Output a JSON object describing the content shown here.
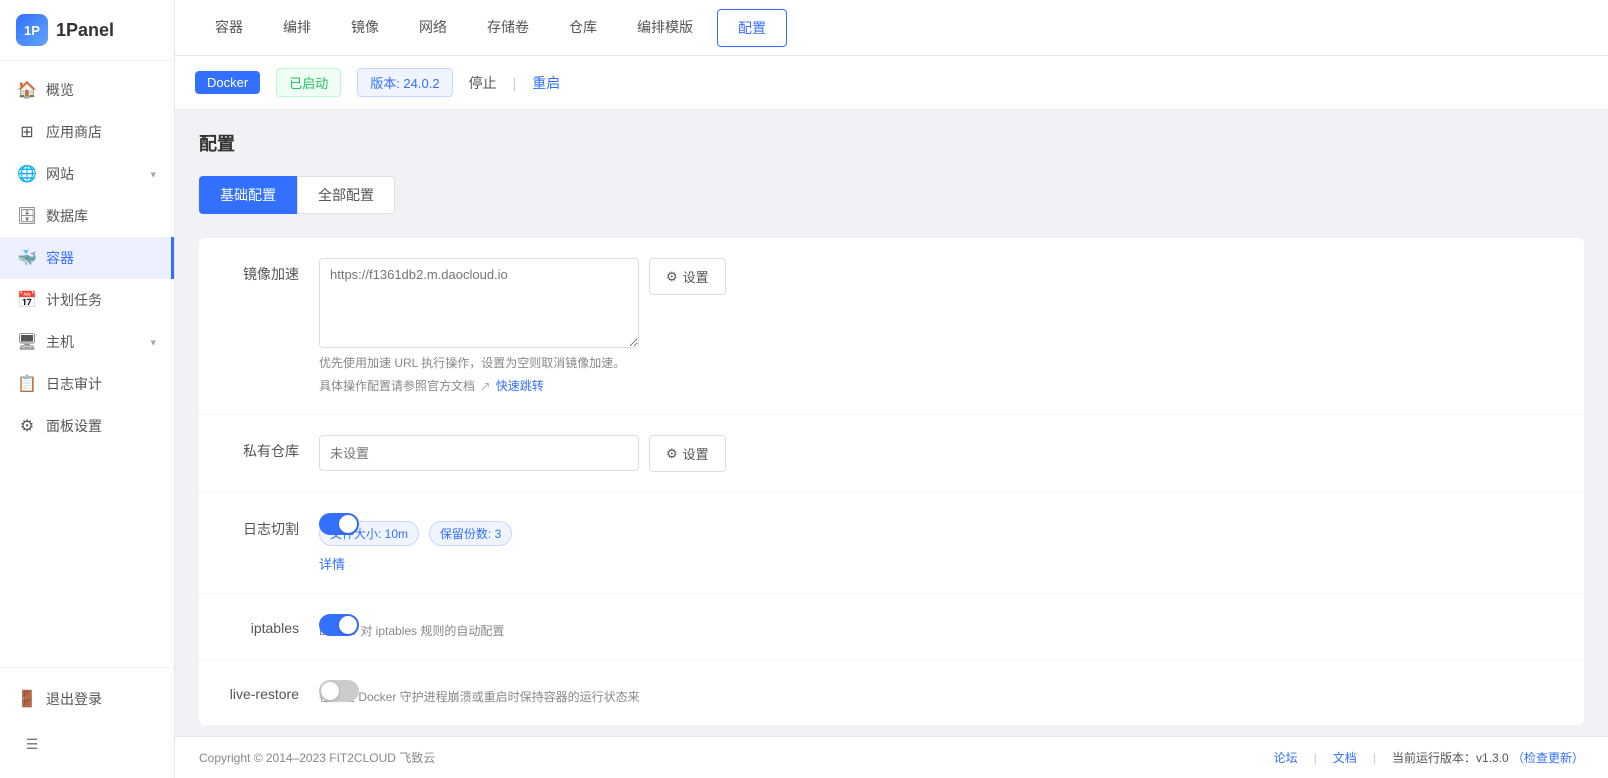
{
  "app": {
    "logo_text": "1Panel"
  },
  "sidebar": {
    "items": [
      {
        "id": "overview",
        "label": "概览",
        "icon": "🏠",
        "active": false,
        "has_arrow": false
      },
      {
        "id": "app-store",
        "label": "应用商店",
        "icon": "⊞",
        "active": false,
        "has_arrow": false
      },
      {
        "id": "website",
        "label": "网站",
        "icon": "🌐",
        "active": false,
        "has_arrow": true
      },
      {
        "id": "database",
        "label": "数据库",
        "icon": "🗄",
        "active": false,
        "has_arrow": false
      },
      {
        "id": "container",
        "label": "容器",
        "icon": "🐳",
        "active": true,
        "has_arrow": false
      },
      {
        "id": "cron",
        "label": "计划任务",
        "icon": "📅",
        "active": false,
        "has_arrow": false
      },
      {
        "id": "host",
        "label": "主机",
        "icon": "🖥",
        "active": false,
        "has_arrow": true
      },
      {
        "id": "log",
        "label": "日志审计",
        "icon": "📋",
        "active": false,
        "has_arrow": false
      },
      {
        "id": "panel-settings",
        "label": "面板设置",
        "icon": "⚙",
        "active": false,
        "has_arrow": false
      }
    ],
    "footer_items": [
      {
        "id": "logout",
        "label": "退出登录",
        "icon": "🚪"
      }
    ]
  },
  "top_tabs": [
    {
      "id": "container",
      "label": "容器",
      "active": false
    },
    {
      "id": "compose",
      "label": "编排",
      "active": false
    },
    {
      "id": "image",
      "label": "镜像",
      "active": false
    },
    {
      "id": "network",
      "label": "网络",
      "active": false
    },
    {
      "id": "volume",
      "label": "存储卷",
      "active": false
    },
    {
      "id": "registry",
      "label": "仓库",
      "active": false
    },
    {
      "id": "compose-template",
      "label": "编排模版",
      "active": false
    },
    {
      "id": "config",
      "label": "配置",
      "active": true
    }
  ],
  "status": {
    "service_name": "Docker",
    "running_label": "已启动",
    "version_label": "版本: 24.0.2",
    "stop_label": "停止",
    "restart_label": "重启"
  },
  "page_title": "配置",
  "config_tabs": [
    {
      "id": "basic",
      "label": "基础配置",
      "active": true
    },
    {
      "id": "all",
      "label": "全部配置",
      "active": false
    }
  ],
  "fields": {
    "mirror_label": "镜像加速",
    "mirror_placeholder": "https://f1361db2.m.daocloud.io",
    "mirror_hint1": "优先使用加速 URL 执行操作，设置为空则取消镜像加速。",
    "mirror_hint2": "具体操作配置请参照官方文档",
    "mirror_link": "快速跳转",
    "setting_btn": "设置",
    "registry_label": "私有仓库",
    "registry_placeholder": "未设置",
    "log_rotate_label": "日志切割",
    "file_size_tag": "文件大小: 10m",
    "retain_count_tag": "保留份数: 3",
    "detail_link": "详情",
    "iptables_label": "iptables",
    "iptables_hint": "Docker 对 iptables 规则的自动配置",
    "live_restore_label": "live-restore",
    "live_restore_hint": "在宿主 Docker 守护进程崩溃或重启时保持容器的运行状态来"
  },
  "footer": {
    "copyright": "Copyright © 2014–2023 FIT2CLOUD 飞致云",
    "forum_label": "论坛",
    "docs_label": "文档",
    "version_label": "当前运行版本：v1.3.0",
    "check_update_label": "（检查更新）"
  },
  "icons": {
    "gear": "⚙",
    "arrow_right": "→",
    "chevron_down": "▾",
    "hamburger": "☰",
    "link": "↗"
  },
  "colors": {
    "primary": "#3370ff",
    "success": "#22c55e",
    "border": "#e8e8e8"
  }
}
